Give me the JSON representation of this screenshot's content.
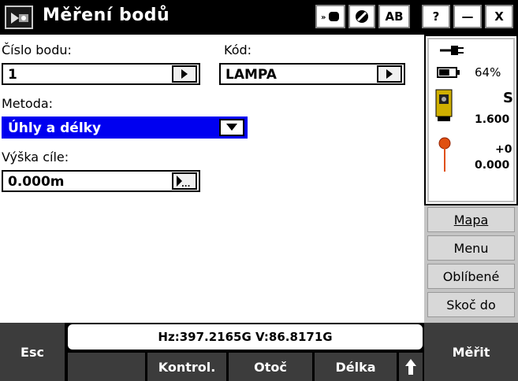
{
  "window": {
    "title": "Měření bodů",
    "btn_ab": "AB",
    "btn_help": "?",
    "btn_min": "—",
    "btn_close": "X"
  },
  "form": {
    "point_number_label": "Číslo bodu:",
    "point_number_value": "1",
    "code_label": "Kód:",
    "code_value": "LAMPA",
    "method_label": "Metoda:",
    "method_value": "Úhly a délky",
    "target_height_label": "Výška cíle:",
    "target_height_value": "0.000m",
    "ellipsis": "..."
  },
  "status": {
    "battery_percent": "64%",
    "instrument_letter": "S",
    "instrument_value": "1.600",
    "target_offset": "+0",
    "target_value": "0.000",
    "battery_level": 0.64
  },
  "rightnav": {
    "map": "Mapa",
    "menu": "Menu",
    "favorites": "Oblíbené",
    "jump_to": "Skoč do"
  },
  "bottom": {
    "esc": "Esc",
    "measure": "Měřit",
    "coords": "Hz:397.2165G  V:86.8171G",
    "check": "Kontrol.",
    "flip": "Otoč",
    "distance": "Délka"
  },
  "colors": {
    "selected_field": "#0000f0",
    "button_dark": "#3c3c3c",
    "nav_bg": "#c4c4c4",
    "target_pin": "#e05010"
  }
}
